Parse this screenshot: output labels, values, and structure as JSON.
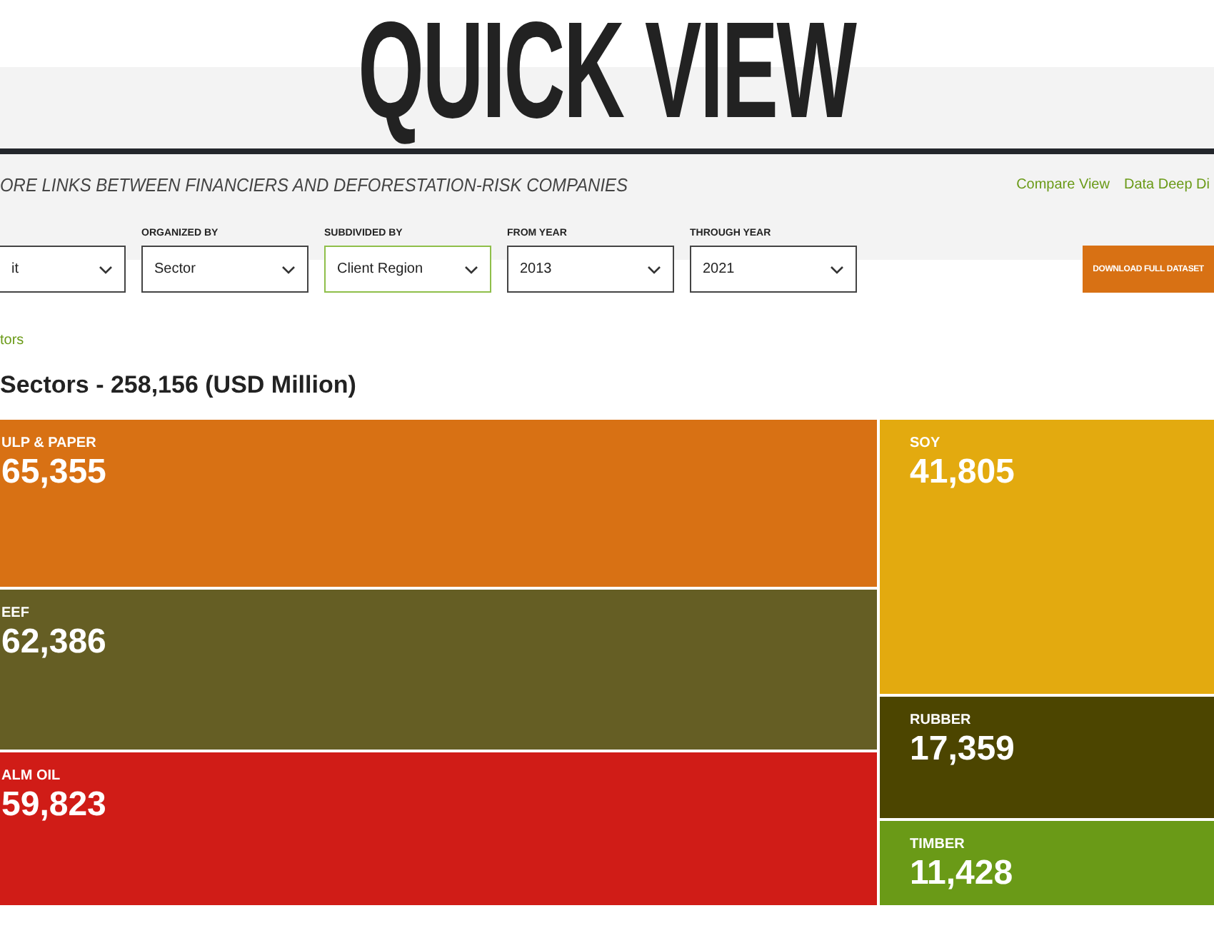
{
  "title": "QUICK VIEW",
  "subtitle": "ORE LINKS BETWEEN FINANCIERS AND DEFORESTATION-RISK COMPANIES",
  "links": [
    "Compare View",
    "Data Deep Di"
  ],
  "filters": [
    {
      "value": "it",
      "highlighted": false
    },
    {
      "label": "ORGANIZED BY",
      "value": "Sector",
      "highlighted": false
    },
    {
      "label": "SUBDIVIDED BY",
      "value": "Client Region",
      "highlighted": true
    },
    {
      "label": "FROM YEAR",
      "value": "2013",
      "highlighted": false
    },
    {
      "label": "THROUGH YEAR",
      "value": "2021",
      "highlighted": false
    }
  ],
  "download_button": "DOWNLOAD FULL DATASET",
  "breadcrumb": "tors",
  "heading": "Sectors - 258,156 (USD Million)",
  "treemap_left": [
    {
      "label": "ULP & PAPER",
      "value": "65,355",
      "color": "#d87114"
    },
    {
      "label": "EEF",
      "value": "62,386",
      "color": "#655e24"
    },
    {
      "label": "ALM OIL",
      "value": "59,823",
      "color": "#d01c17"
    }
  ],
  "treemap_right": [
    {
      "label": "SOY",
      "value": "41,805",
      "color": "#e3aa0f"
    },
    {
      "label": "RUBBER",
      "value": "17,359",
      "color": "#4c4500"
    },
    {
      "label": "TIMBER",
      "value": "11,428",
      "color": "#6a9a17"
    }
  ]
}
